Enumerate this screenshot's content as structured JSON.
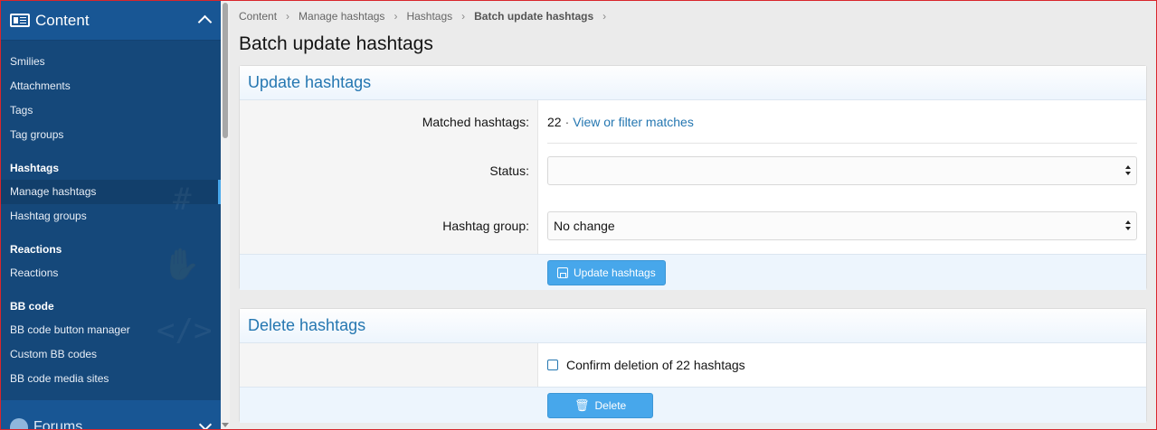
{
  "sidebar": {
    "section_title": "Content",
    "items": [
      {
        "label": "Smilies"
      },
      {
        "label": "Attachments"
      },
      {
        "label": "Tags"
      },
      {
        "label": "Tag groups"
      }
    ],
    "hashtags_group": {
      "title": "Hashtags",
      "items": [
        {
          "label": "Manage hashtags",
          "active": true
        },
        {
          "label": "Hashtag groups"
        }
      ]
    },
    "reactions_group": {
      "title": "Reactions",
      "items": [
        {
          "label": "Reactions"
        }
      ]
    },
    "bbcode_group": {
      "title": "BB code",
      "items": [
        {
          "label": "BB code button manager"
        },
        {
          "label": "Custom BB codes"
        },
        {
          "label": "BB code media sites"
        }
      ]
    },
    "footer_label": "Forums"
  },
  "breadcrumb": {
    "items": [
      "Content",
      "Manage hashtags",
      "Hashtags",
      "Batch update hashtags"
    ]
  },
  "page_title": "Batch update hashtags",
  "update_block": {
    "title": "Update hashtags",
    "matched_label": "Matched hashtags:",
    "matched_count": "22",
    "matched_sep": "·",
    "matched_link": "View or filter matches",
    "status_label": "Status:",
    "status_value": "",
    "group_label": "Hashtag group:",
    "group_value": "No change",
    "submit_label": "Update hashtags"
  },
  "delete_block": {
    "title": "Delete hashtags",
    "confirm_label": "Confirm deletion of 22 hashtags",
    "confirm_checked": false,
    "delete_label": "Delete"
  },
  "colors": {
    "sidebar_bg": "#15487a",
    "accent": "#47a7eb",
    "link": "#2577b1",
    "header_text": "#2577b1"
  }
}
